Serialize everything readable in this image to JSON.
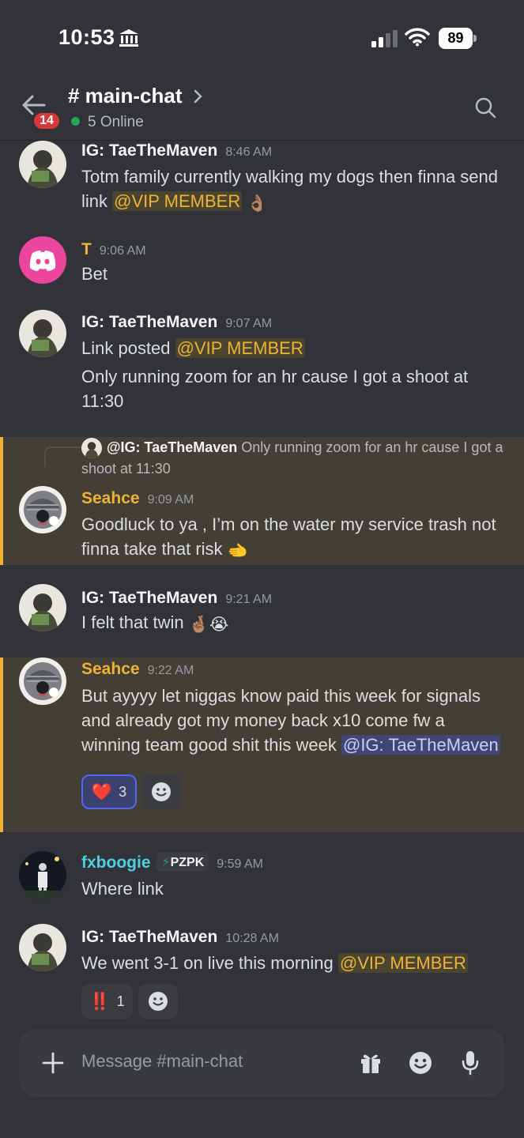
{
  "status_bar": {
    "time": "10:53",
    "battery": "89"
  },
  "header": {
    "unread_badge": "14",
    "channel_name": "# main-chat",
    "online": "5 Online"
  },
  "messages": [
    {
      "author": "IG: TaeTheMaven",
      "time": "8:46 AM",
      "text": "Totm family currently walking my dogs then finna send link",
      "mention": "@VIP MEMBER"
    },
    {
      "author": "T",
      "time": "9:06 AM",
      "text": "Bet"
    },
    {
      "author": "IG: TaeTheMaven",
      "time": "9:07 AM",
      "text": "Link posted",
      "mention": "@VIP MEMBER",
      "text2": "Only running zoom for an hr cause I got a shoot at 11:30"
    },
    {
      "reply_author": "@IG: TaeTheMaven",
      "reply_text": "Only running zoom for an hr cause I got a shoot at 11:30",
      "author": "Seahce",
      "time": "9:09 AM",
      "text": "Goodluck to ya , I’m on the water my service trash not finna take that risk"
    },
    {
      "author": "IG: TaeTheMaven",
      "time": "9:21 AM",
      "text": "I felt that twin"
    },
    {
      "author": "Seahce",
      "time": "9:22 AM",
      "text": "But ayyyy let niggas know paid this week for signals and already got my money back x10 come fw a winning team good shit this week",
      "mention": "@IG: TaeTheMaven",
      "reaction_count": "3"
    },
    {
      "author": "fxboogie",
      "tag": "PZPK",
      "time": "9:59 AM",
      "text": "Where link"
    },
    {
      "author": "IG: TaeTheMaven",
      "time": "10:28 AM",
      "text": "We went 3-1 on live this morning",
      "mention": "@VIP MEMBER",
      "reaction_count": "1"
    }
  ],
  "composer": {
    "placeholder": "Message #main-chat"
  }
}
